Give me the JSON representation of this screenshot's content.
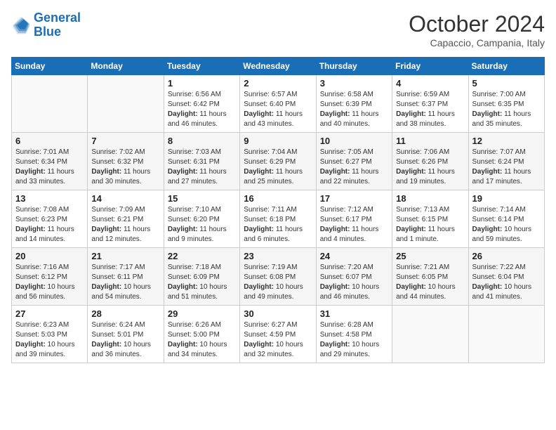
{
  "logo": {
    "text_general": "General",
    "text_blue": "Blue"
  },
  "title": "October 2024",
  "location": "Capaccio, Campania, Italy",
  "days_of_week": [
    "Sunday",
    "Monday",
    "Tuesday",
    "Wednesday",
    "Thursday",
    "Friday",
    "Saturday"
  ],
  "weeks": [
    [
      {
        "day": "",
        "info": ""
      },
      {
        "day": "",
        "info": ""
      },
      {
        "day": "1",
        "info": "Sunrise: 6:56 AM\nSunset: 6:42 PM\nDaylight: 11 hours and 46 minutes."
      },
      {
        "day": "2",
        "info": "Sunrise: 6:57 AM\nSunset: 6:40 PM\nDaylight: 11 hours and 43 minutes."
      },
      {
        "day": "3",
        "info": "Sunrise: 6:58 AM\nSunset: 6:39 PM\nDaylight: 11 hours and 40 minutes."
      },
      {
        "day": "4",
        "info": "Sunrise: 6:59 AM\nSunset: 6:37 PM\nDaylight: 11 hours and 38 minutes."
      },
      {
        "day": "5",
        "info": "Sunrise: 7:00 AM\nSunset: 6:35 PM\nDaylight: 11 hours and 35 minutes."
      }
    ],
    [
      {
        "day": "6",
        "info": "Sunrise: 7:01 AM\nSunset: 6:34 PM\nDaylight: 11 hours and 33 minutes."
      },
      {
        "day": "7",
        "info": "Sunrise: 7:02 AM\nSunset: 6:32 PM\nDaylight: 11 hours and 30 minutes."
      },
      {
        "day": "8",
        "info": "Sunrise: 7:03 AM\nSunset: 6:31 PM\nDaylight: 11 hours and 27 minutes."
      },
      {
        "day": "9",
        "info": "Sunrise: 7:04 AM\nSunset: 6:29 PM\nDaylight: 11 hours and 25 minutes."
      },
      {
        "day": "10",
        "info": "Sunrise: 7:05 AM\nSunset: 6:27 PM\nDaylight: 11 hours and 22 minutes."
      },
      {
        "day": "11",
        "info": "Sunrise: 7:06 AM\nSunset: 6:26 PM\nDaylight: 11 hours and 19 minutes."
      },
      {
        "day": "12",
        "info": "Sunrise: 7:07 AM\nSunset: 6:24 PM\nDaylight: 11 hours and 17 minutes."
      }
    ],
    [
      {
        "day": "13",
        "info": "Sunrise: 7:08 AM\nSunset: 6:23 PM\nDaylight: 11 hours and 14 minutes."
      },
      {
        "day": "14",
        "info": "Sunrise: 7:09 AM\nSunset: 6:21 PM\nDaylight: 11 hours and 12 minutes."
      },
      {
        "day": "15",
        "info": "Sunrise: 7:10 AM\nSunset: 6:20 PM\nDaylight: 11 hours and 9 minutes."
      },
      {
        "day": "16",
        "info": "Sunrise: 7:11 AM\nSunset: 6:18 PM\nDaylight: 11 hours and 6 minutes."
      },
      {
        "day": "17",
        "info": "Sunrise: 7:12 AM\nSunset: 6:17 PM\nDaylight: 11 hours and 4 minutes."
      },
      {
        "day": "18",
        "info": "Sunrise: 7:13 AM\nSunset: 6:15 PM\nDaylight: 11 hours and 1 minute."
      },
      {
        "day": "19",
        "info": "Sunrise: 7:14 AM\nSunset: 6:14 PM\nDaylight: 10 hours and 59 minutes."
      }
    ],
    [
      {
        "day": "20",
        "info": "Sunrise: 7:16 AM\nSunset: 6:12 PM\nDaylight: 10 hours and 56 minutes."
      },
      {
        "day": "21",
        "info": "Sunrise: 7:17 AM\nSunset: 6:11 PM\nDaylight: 10 hours and 54 minutes."
      },
      {
        "day": "22",
        "info": "Sunrise: 7:18 AM\nSunset: 6:09 PM\nDaylight: 10 hours and 51 minutes."
      },
      {
        "day": "23",
        "info": "Sunrise: 7:19 AM\nSunset: 6:08 PM\nDaylight: 10 hours and 49 minutes."
      },
      {
        "day": "24",
        "info": "Sunrise: 7:20 AM\nSunset: 6:07 PM\nDaylight: 10 hours and 46 minutes."
      },
      {
        "day": "25",
        "info": "Sunrise: 7:21 AM\nSunset: 6:05 PM\nDaylight: 10 hours and 44 minutes."
      },
      {
        "day": "26",
        "info": "Sunrise: 7:22 AM\nSunset: 6:04 PM\nDaylight: 10 hours and 41 minutes."
      }
    ],
    [
      {
        "day": "27",
        "info": "Sunrise: 6:23 AM\nSunset: 5:03 PM\nDaylight: 10 hours and 39 minutes."
      },
      {
        "day": "28",
        "info": "Sunrise: 6:24 AM\nSunset: 5:01 PM\nDaylight: 10 hours and 36 minutes."
      },
      {
        "day": "29",
        "info": "Sunrise: 6:26 AM\nSunset: 5:00 PM\nDaylight: 10 hours and 34 minutes."
      },
      {
        "day": "30",
        "info": "Sunrise: 6:27 AM\nSunset: 4:59 PM\nDaylight: 10 hours and 32 minutes."
      },
      {
        "day": "31",
        "info": "Sunrise: 6:28 AM\nSunset: 4:58 PM\nDaylight: 10 hours and 29 minutes."
      },
      {
        "day": "",
        "info": ""
      },
      {
        "day": "",
        "info": ""
      }
    ]
  ]
}
